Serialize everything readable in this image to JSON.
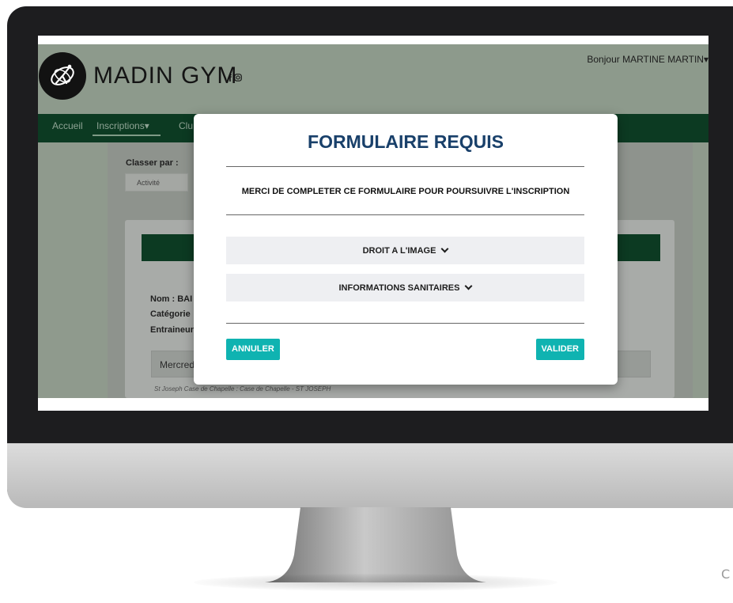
{
  "header": {
    "brand": "MADIN GYM",
    "social_text": "f◎",
    "greeting": "Bonjour MARTINE MARTIN▾"
  },
  "nav": {
    "accueil": "Accueil",
    "inscriptions": "Inscriptions▾",
    "cut_item": "Clu"
  },
  "filters": {
    "classer_label": "Classer par :",
    "selected_value": "Activité"
  },
  "card": {
    "nom": "Nom : BAI",
    "categorie": "Catégorie",
    "entraineur": "Entraineur",
    "schedule_tab": "Mercred",
    "location": "St Joseph Case de Chapelle : Case de Chapelle - ST JOSEPH"
  },
  "modal": {
    "title": "FORMULAIRE REQUIS",
    "message": "MERCI DE COMPLETER CE FORMULAIRE POUR POURSUIVRE L'INSCRIPTION",
    "sections": [
      {
        "label": "DROIT A L'IMAGE"
      },
      {
        "label": "INFORMATIONS SANITAIRES"
      }
    ],
    "cancel_label": "ANNULER",
    "validate_label": "VALIDER"
  },
  "colors": {
    "modal_title": "#19406a",
    "accent_button": "#0fb3b1",
    "navbar": "#0c3a22",
    "header": "#8d9a8c"
  },
  "icons": [
    "logo-gymnast-icon",
    "facebook-icon",
    "instagram-icon",
    "chevron-down-icon"
  ]
}
